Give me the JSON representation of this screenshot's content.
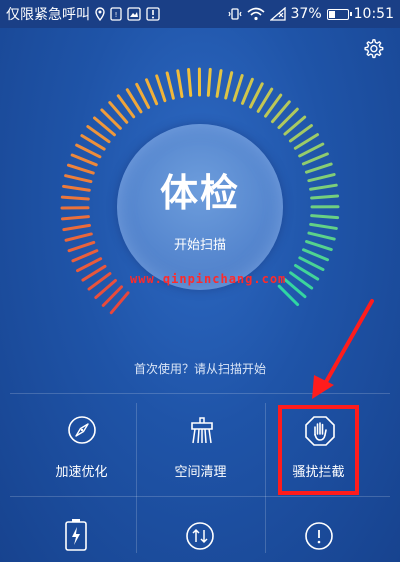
{
  "status_bar": {
    "carrier_text": "仅限紧急呼叫",
    "battery_percent": "37%",
    "battery_level": 0.37,
    "time": "10:51"
  },
  "scan": {
    "title": "体检",
    "button_label": "开始扫描",
    "hint": "首次使用？请从扫描开始"
  },
  "watermark": "www.qinpinchang.com",
  "tiles": [
    {
      "label": "加速优化",
      "icon": "compass-icon"
    },
    {
      "label": "空间清理",
      "icon": "broom-icon"
    },
    {
      "label": "骚扰拦截",
      "icon": "hand-stop-icon"
    }
  ],
  "row2_icons": [
    "battery-charge-icon",
    "data-transfer-icon",
    "info-icon"
  ],
  "colors": {
    "background": "#1f54a8",
    "highlight": "#ff1c1c",
    "gauge_start": "#e8473c",
    "gauge_mid": "#f2c23a",
    "gauge_end": "#2fd6a3"
  }
}
